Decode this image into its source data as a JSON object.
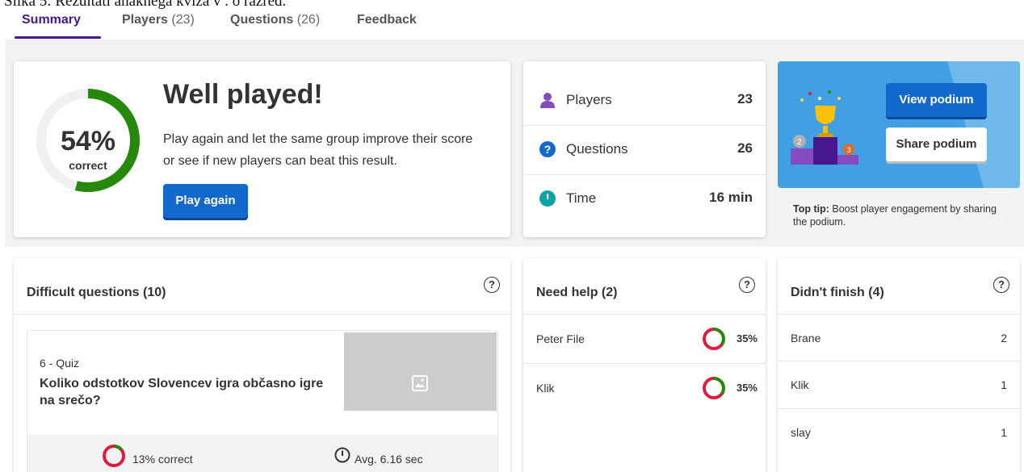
{
  "caption": "Slika 5: Rezultati anaknega kviza  v . o razred.",
  "tabs": [
    {
      "label": "Summary",
      "count": ""
    },
    {
      "label": "Players",
      "count": "(23)"
    },
    {
      "label": "Questions",
      "count": "(26)"
    },
    {
      "label": "Feedback",
      "count": ""
    }
  ],
  "summary": {
    "percent": "54%",
    "percent_value": 54,
    "correct_label": "correct",
    "title": "Well played!",
    "description": "Play again and let the same group improve their score or see if new players can beat this result.",
    "play_again": "Play again"
  },
  "stats": {
    "players_label": "Players",
    "players_value": "23",
    "questions_label": "Questions",
    "questions_value": "26",
    "time_label": "Time",
    "time_value": "16 min"
  },
  "podium": {
    "view_button": "View podium",
    "share_button": "Share podium",
    "tip_bold": "Top tip:",
    "tip_text": " Boost player engagement by sharing the podium."
  },
  "difficult": {
    "title": "Difficult questions (10)",
    "question_type": "6 - Quiz",
    "question_text": "Koliko odstotkov Slovencev igra občasno igre na srečo?",
    "correct": "13% correct",
    "correct_value": 13,
    "avg_time": "Avg. 6.16 sec"
  },
  "need_help": {
    "title": "Need help (2)",
    "rows": [
      {
        "name": "Peter File",
        "percent": "35%",
        "value": 35
      },
      {
        "name": "Klik",
        "percent": "35%",
        "value": 35
      }
    ]
  },
  "didnt_finish": {
    "title": "Didn't finish (4)",
    "rows": [
      {
        "name": "Brane",
        "count": "2"
      },
      {
        "name": "Klik",
        "count": "1"
      },
      {
        "name": "slay",
        "count": "1"
      }
    ]
  },
  "help_symbol": "?",
  "colors": {
    "accent": "#46178f",
    "button": "#1368ce",
    "ring_green": "#26890c",
    "ring_red": "#e21b3c",
    "podium_bg": "#41a0e3"
  }
}
